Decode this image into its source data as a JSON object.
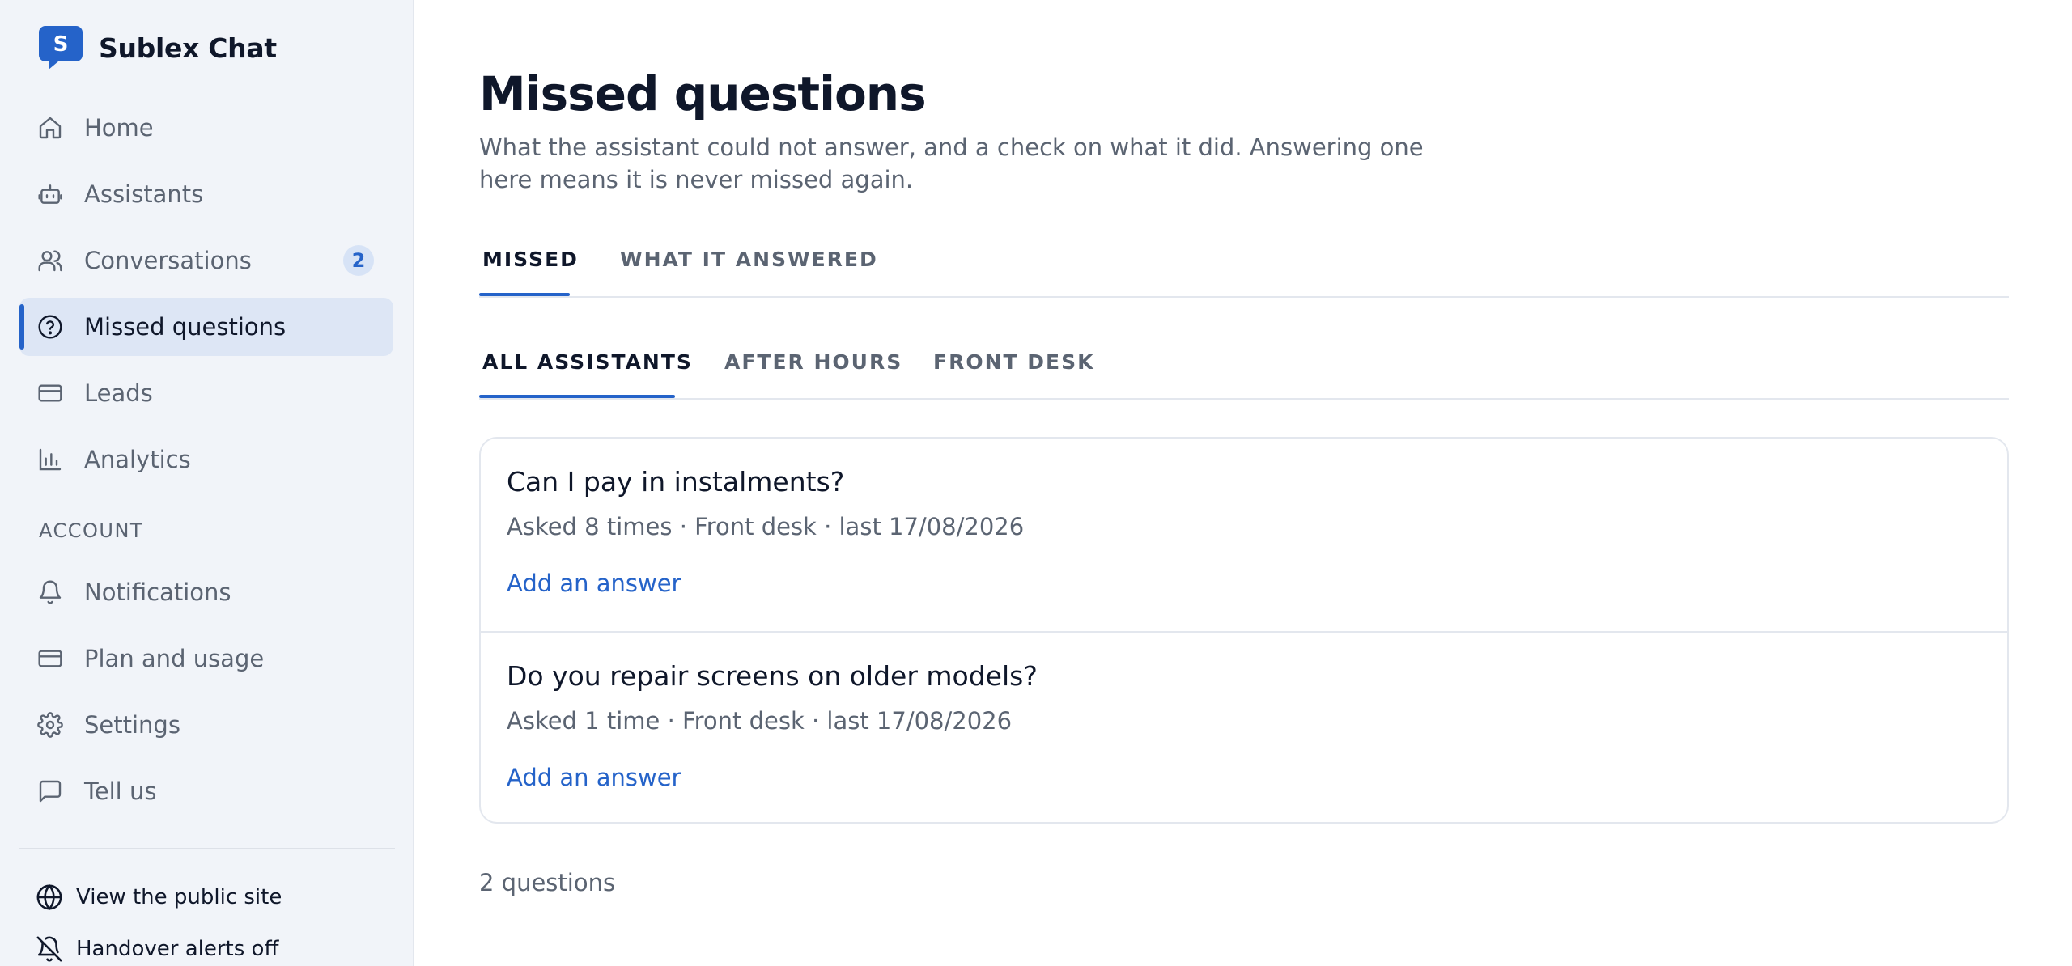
{
  "brand": {
    "name": "Sublex Chat",
    "logo_letter": "S",
    "color": "#2563c9"
  },
  "nav": {
    "items": [
      {
        "label": "Home",
        "icon": "home-icon"
      },
      {
        "label": "Assistants",
        "icon": "bot-icon"
      },
      {
        "label": "Conversations",
        "icon": "users-icon",
        "badge": "2"
      },
      {
        "label": "Missed questions",
        "icon": "help-circle-icon",
        "active": true
      },
      {
        "label": "Leads",
        "icon": "card-icon"
      },
      {
        "label": "Analytics",
        "icon": "bar-chart-icon"
      }
    ],
    "account_label": "ACCOUNT",
    "account_items": [
      {
        "label": "Notifications",
        "icon": "bell-icon"
      },
      {
        "label": "Plan and usage",
        "icon": "card-icon"
      },
      {
        "label": "Settings",
        "icon": "gear-icon"
      },
      {
        "label": "Tell us",
        "icon": "message-icon"
      }
    ],
    "footer": [
      {
        "label": "View the public site",
        "icon": "globe-icon"
      },
      {
        "label": "Handover alerts off",
        "icon": "bell-off-icon"
      }
    ]
  },
  "page": {
    "title": "Missed questions",
    "description": "What the assistant could not answer, and a check on what it did. Answering one here means it is never missed again."
  },
  "tabs": [
    "MISSED",
    "WHAT IT ANSWERED"
  ],
  "subtabs": [
    "ALL ASSISTANTS",
    "AFTER HOURS",
    "FRONT DESK"
  ],
  "questions": [
    {
      "title": "Can I pay in instalments?",
      "meta": "Asked 8 times · Front desk · last 17/08/2026",
      "action": "Add an answer"
    },
    {
      "title": "Do you repair screens on older models?",
      "meta": "Asked 1 time · Front desk · last 17/08/2026",
      "action": "Add an answer"
    }
  ],
  "count_label": "2 questions",
  "colors": {
    "accent": "#2563c9",
    "sidebar_bg": "#f1f4f9",
    "active_bg": "#dde6f5"
  }
}
